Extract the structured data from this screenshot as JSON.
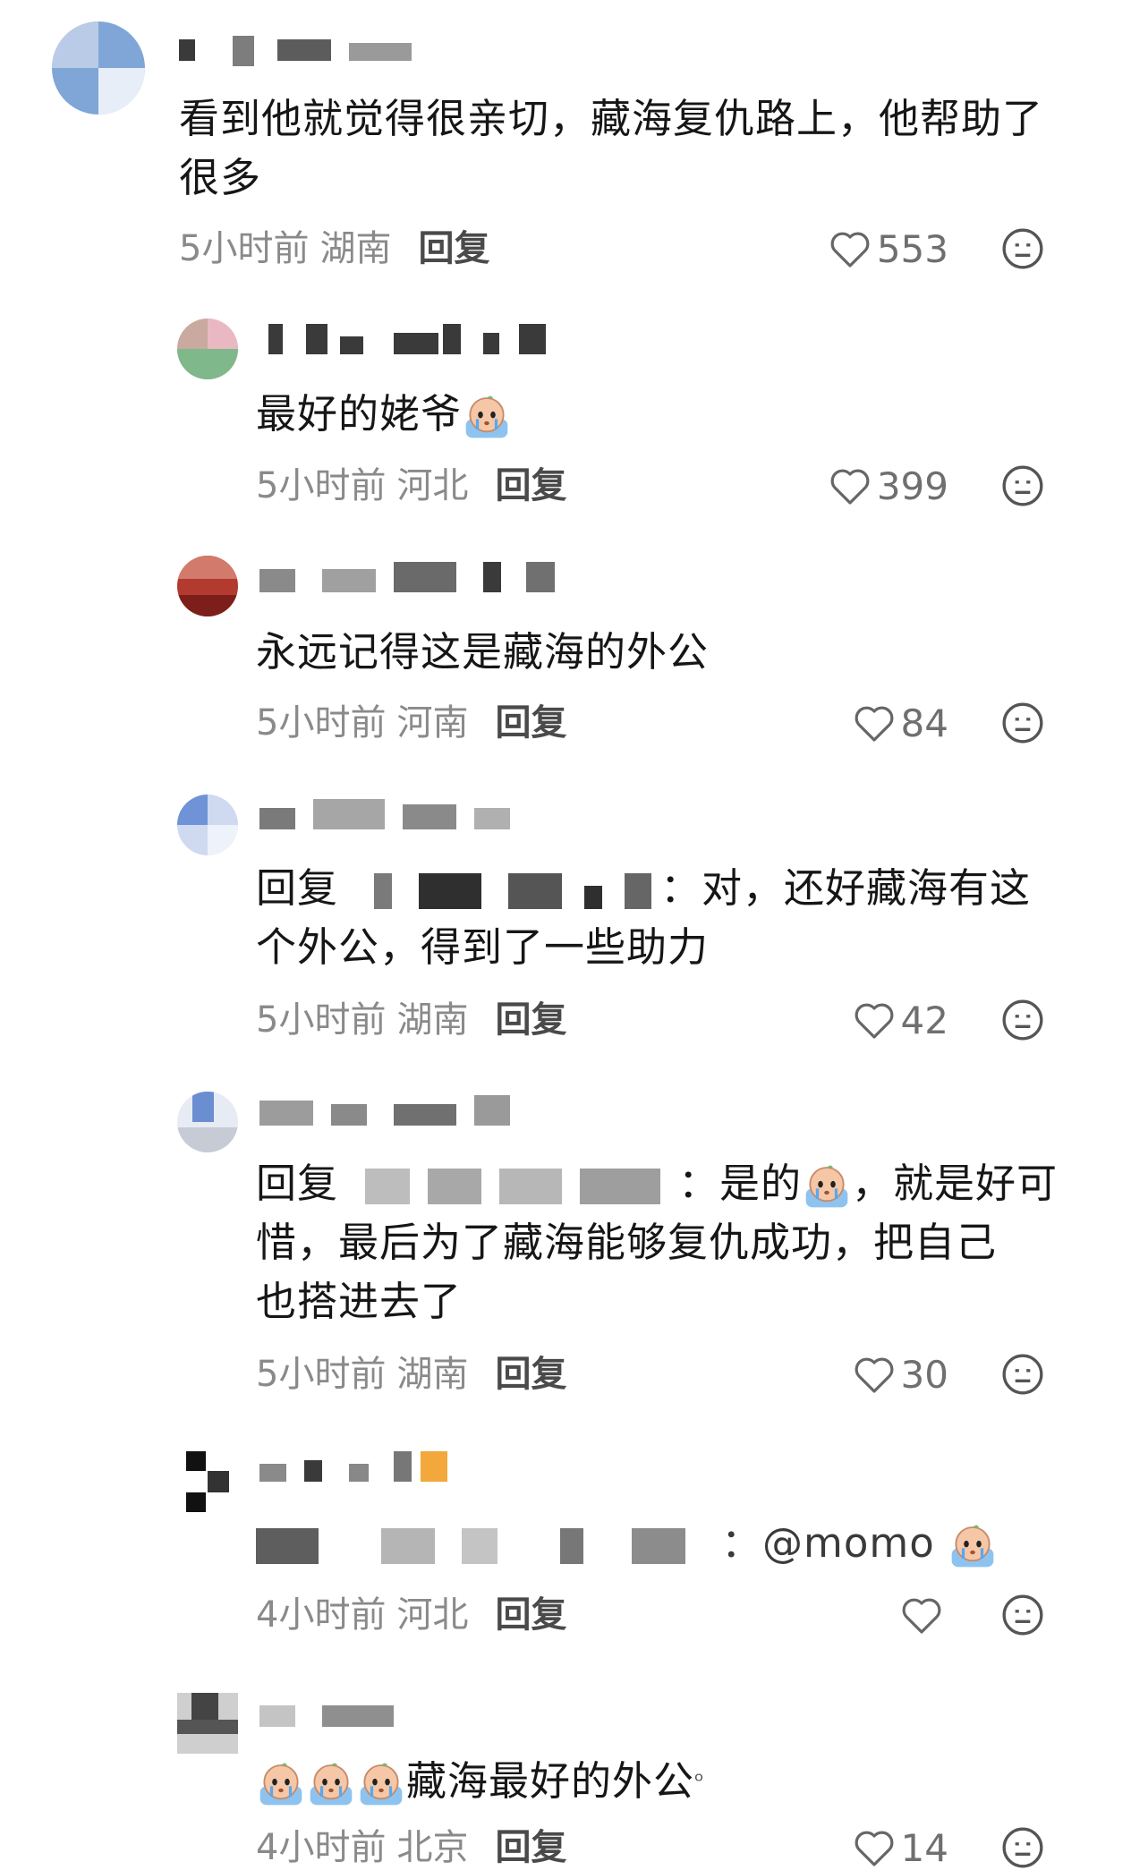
{
  "comments": [
    {
      "text": "看到他就觉得很亲切，藏海复仇路上，他帮助了很多",
      "time": "5小时前",
      "location": "湖南",
      "reply_label": "回复",
      "likes": "553"
    },
    {
      "text": "最好的姥爷",
      "time": "5小时前",
      "location": "河北",
      "reply_label": "回复",
      "likes": "399"
    },
    {
      "text": "永远记得这是藏海的外公",
      "time": "5小时前",
      "location": "河南",
      "reply_label": "回复",
      "likes": "84"
    },
    {
      "prefix": "回复",
      "text": "：对，还好藏海有这",
      "text_line2": "个外公，得到了一些助力",
      "time": "5小时前",
      "location": "湖南",
      "reply_label": "回复",
      "likes": "42"
    },
    {
      "prefix": "回复",
      "text": "：是的",
      "text_after_emoji": "，就是好可",
      "text_line2": "惜，最后为了藏海能够复仇成功，把自己",
      "text_line3": "也搭进去了",
      "time": "5小时前",
      "location": "湖南",
      "reply_label": "回复",
      "likes": "30"
    },
    {
      "text": "：@momo",
      "time": "4小时前",
      "location": "河北",
      "reply_label": "回复",
      "likes": ""
    },
    {
      "text": "藏海最好的外公",
      "time": "4小时前",
      "location": "北京",
      "reply_label": "回复",
      "likes": "14"
    }
  ],
  "icons": {
    "like": "heart-outline-icon",
    "dislike": "neutral-face-icon",
    "emoji": "crying-emoji"
  }
}
